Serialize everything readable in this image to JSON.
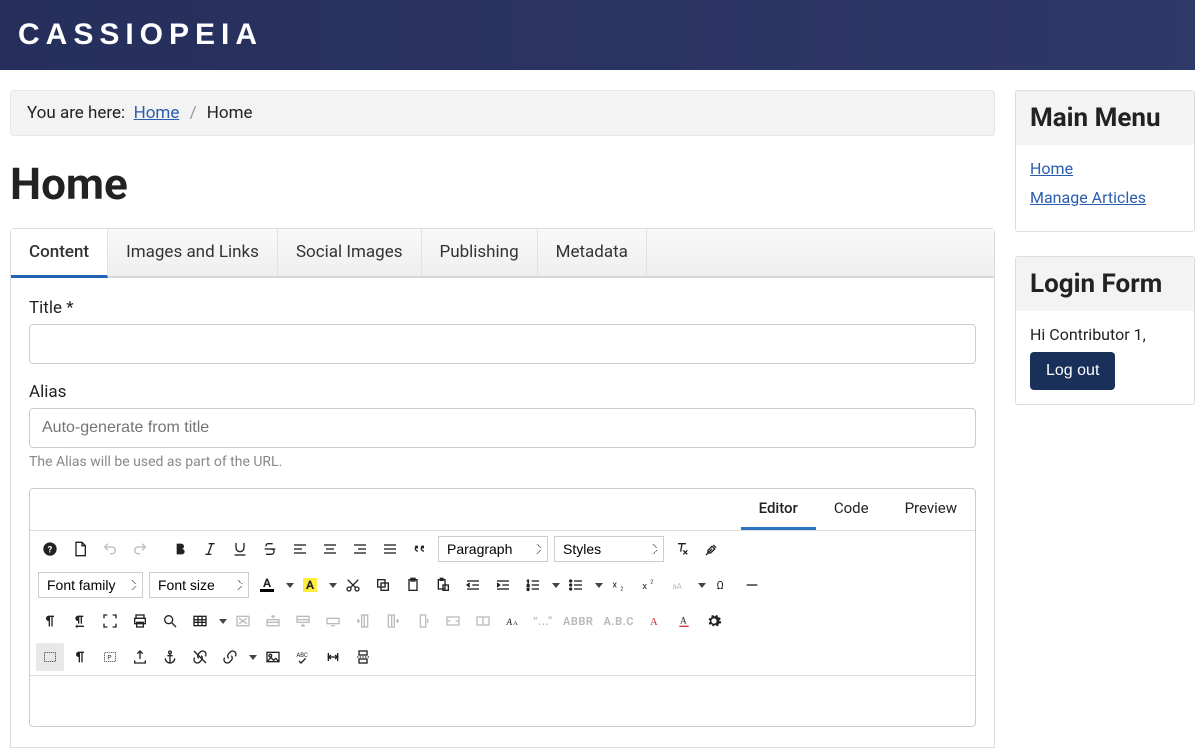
{
  "brand": "CASSIOPEIA",
  "breadcrumb": {
    "label": "You are here:",
    "home": "Home",
    "current": "Home"
  },
  "page_title": "Home",
  "tabs": [
    "Content",
    "Images and Links",
    "Social Images",
    "Publishing",
    "Metadata"
  ],
  "fields": {
    "title_label": "Title *",
    "title_value": "",
    "alias_label": "Alias",
    "alias_placeholder": "Auto-generate from title",
    "alias_value": "",
    "alias_hint": "The Alias will be used as part of the URL."
  },
  "editor_tabs": [
    "Editor",
    "Code",
    "Preview"
  ],
  "toolbar": {
    "paragraph": "Paragraph",
    "styles": "Styles",
    "font_family": "Font family",
    "font_size": "Font size",
    "quotes_btn": "“...”",
    "abbr_btn": "ABBR",
    "abc_btn": "A.B.C"
  },
  "sidebar": {
    "main_menu": {
      "title": "Main Menu",
      "items": [
        "Home",
        "Manage Articles"
      ]
    },
    "login": {
      "title": "Login Form",
      "greeting": "Hi Contributor 1,",
      "logout": "Log out"
    }
  }
}
